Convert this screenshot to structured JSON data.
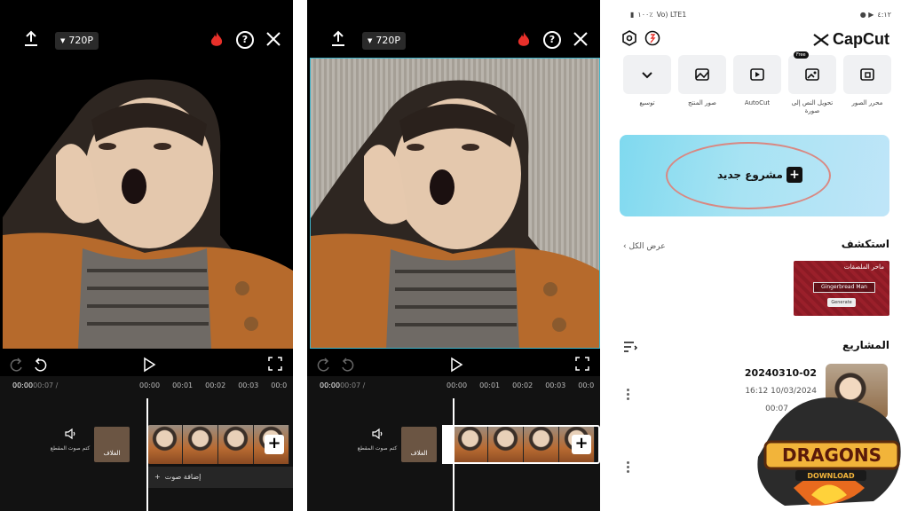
{
  "editor_left": {
    "resolution": "720P",
    "timecode_current": "00:00",
    "timecode_total": "00:07 /",
    "ticks": [
      "00:00",
      "00:01",
      "00:02",
      "00:03",
      "00:0"
    ],
    "mute_label": "كتم صوت المقطع",
    "cover_label": "الغلاف",
    "add_audio": "إضافة صوت",
    "add_audio_plus": "+",
    "add_clip": "+"
  },
  "editor_right": {
    "resolution": "720P",
    "timecode_current": "00:00",
    "timecode_total": "00:07 /",
    "ticks": [
      "00:00",
      "00:01",
      "00:02",
      "00:03",
      "00:0"
    ],
    "mute_label": "كتم صوت المقطع",
    "cover_label": "الغلاف",
    "add_clip": "+"
  },
  "home": {
    "status_time": "٤:١٢",
    "status_battery": "١٠٠٪",
    "status_net": "Vo) LTE1",
    "brand": "CapCut",
    "tools": [
      {
        "label": "محرر الصور",
        "icon": "photo-editor-icon"
      },
      {
        "label": "تحويل النص إلى صورة",
        "icon": "text-to-image-icon",
        "badge": "Free"
      },
      {
        "label": "AutoCut",
        "icon": "autocut-icon"
      },
      {
        "label": "صور المنتج",
        "icon": "product-photo-icon"
      },
      {
        "label": "توسيع",
        "icon": "expand-icon"
      }
    ],
    "new_project": "مشروع جديد",
    "explore_title": "استكشف",
    "view_all": "عرض الكل",
    "promo": {
      "title": "ماحر الملصقات",
      "input": "Gingerbread Man",
      "button": "Generate"
    },
    "projects_title": "المشاريع",
    "project": {
      "name": "20240310-02",
      "date": "16:12 10/03/2024",
      "duration": "00:07"
    }
  },
  "colors": {
    "accent_fire": "#e8302a",
    "capcut_black": "#111111",
    "new_project_bg": "#8fdcf1",
    "oval": "#d98882"
  }
}
